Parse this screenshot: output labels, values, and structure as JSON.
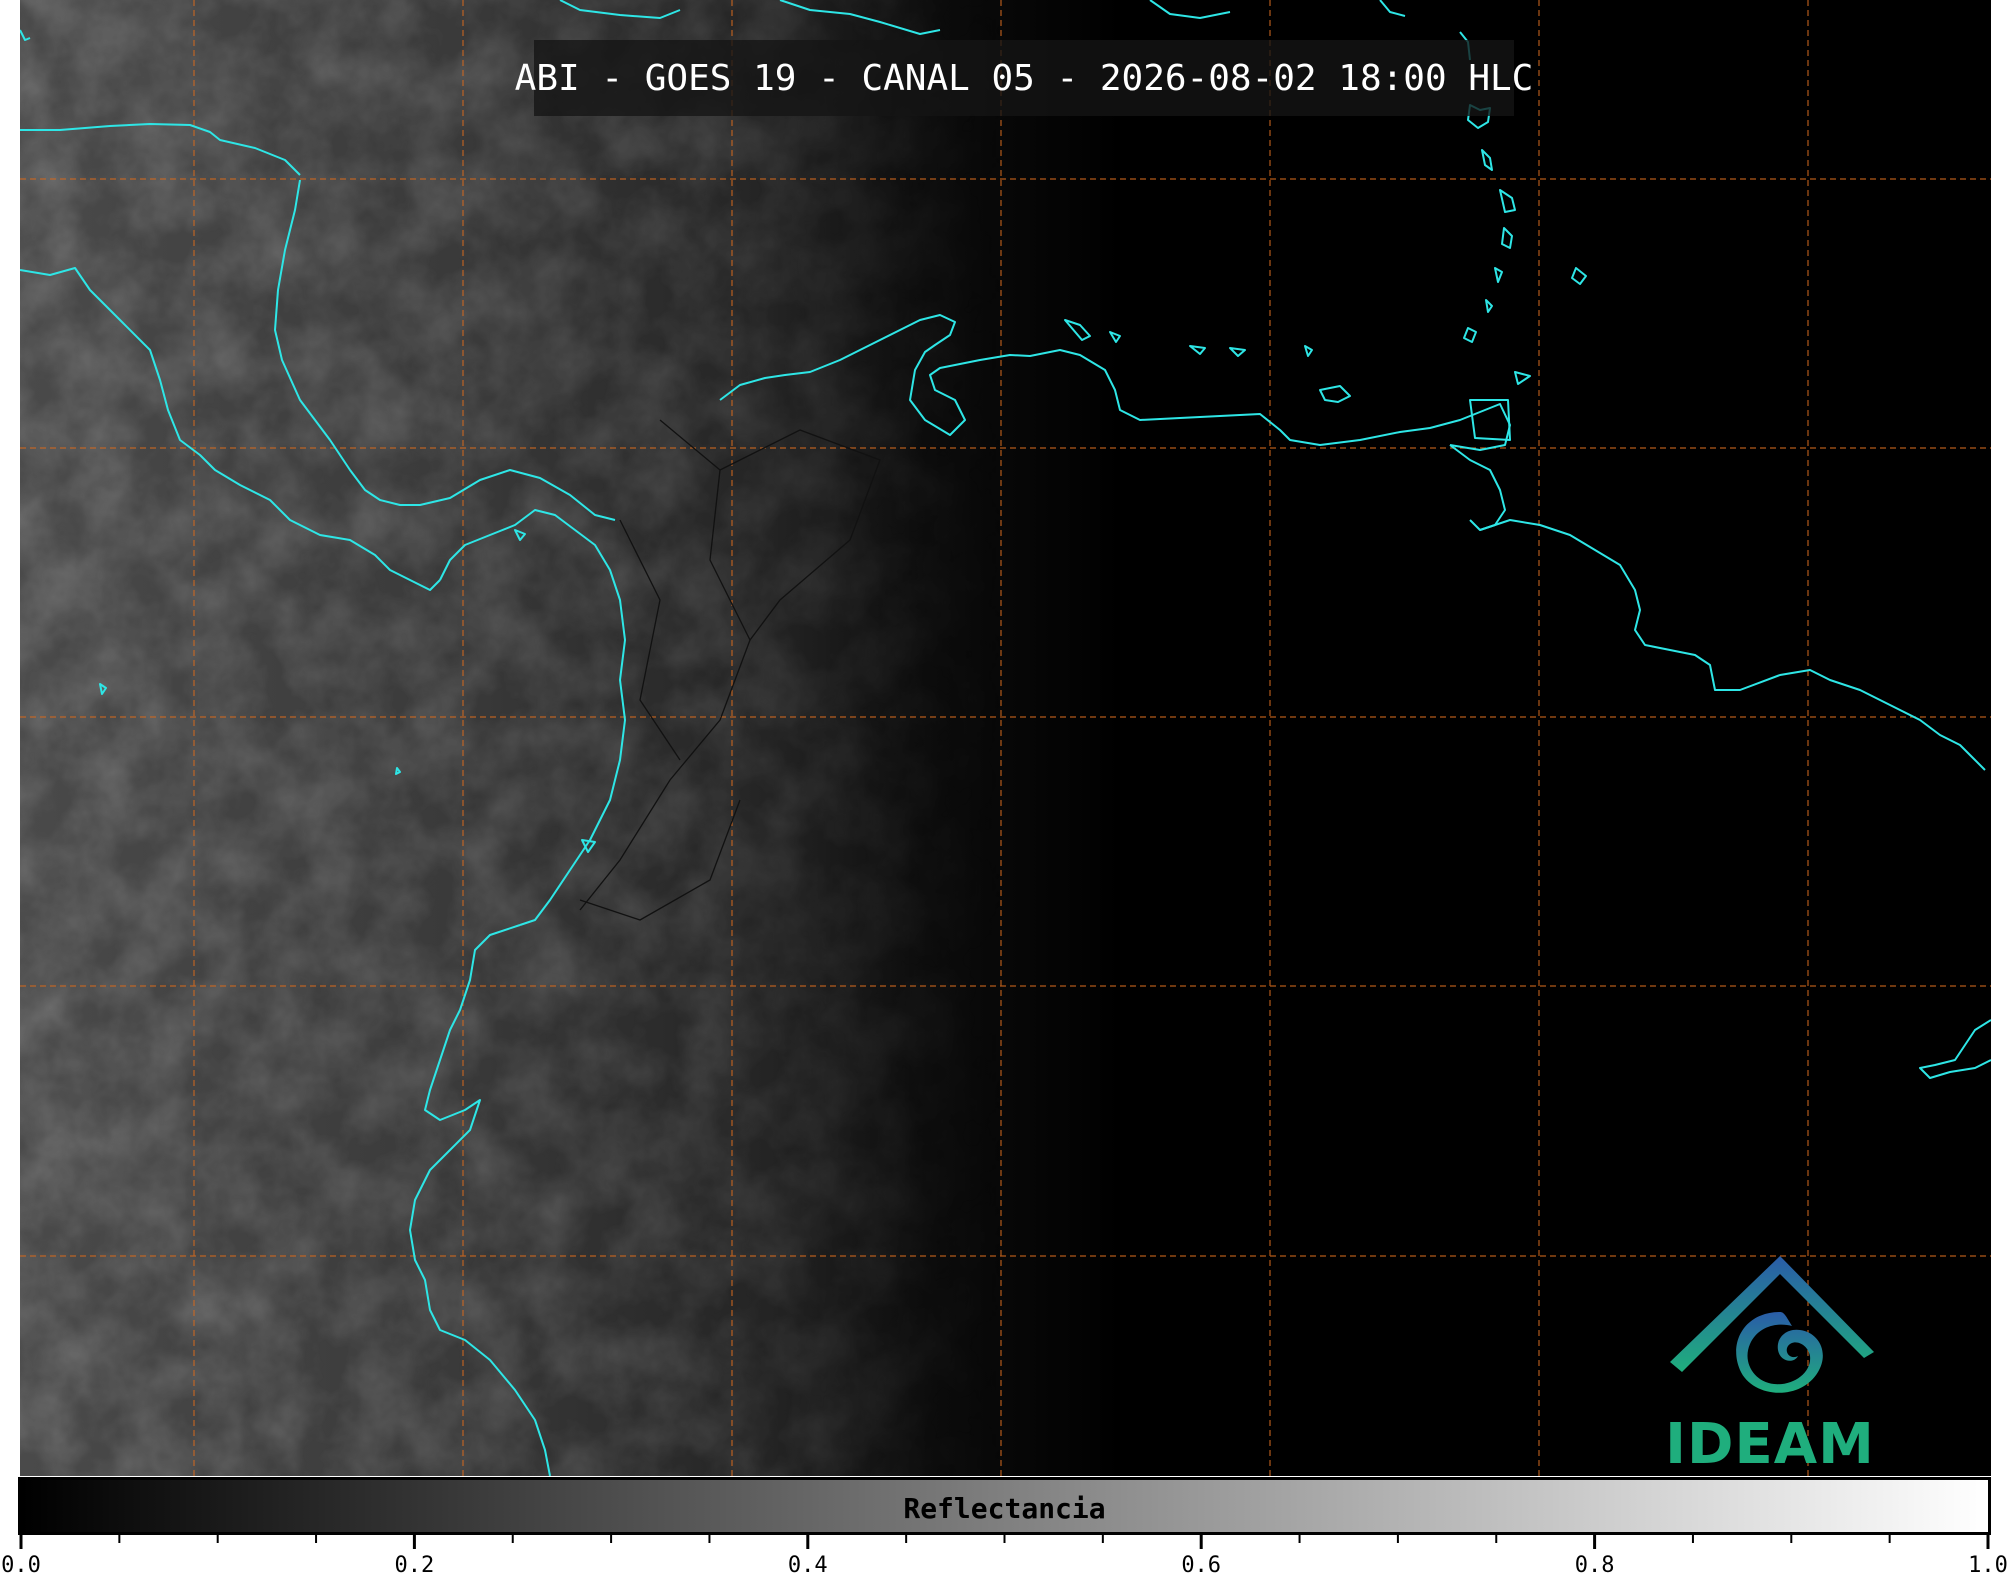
{
  "title": "ABI - GOES 19 - CANAL 05 - 2026-08-02 18:00 HLC",
  "colorbar": {
    "label": "Reflectancia",
    "min": 0.0,
    "max": 1.0,
    "tick_labels": [
      "0.0",
      "0.2",
      "0.4",
      "0.6",
      "0.8",
      "1.0"
    ],
    "minor_tick_step": 0.05
  },
  "logo": {
    "text": "IDEAM"
  },
  "colors": {
    "coastline": "#2ee6e6",
    "gridline": "#d2691e",
    "background": "#000000",
    "logo_top": "#2a5ca8",
    "logo_bottom": "#1fae7d"
  },
  "map": {
    "gridline_style": "dashed",
    "image_description_style": "grayscale visible reflectance, brighter to the west"
  }
}
